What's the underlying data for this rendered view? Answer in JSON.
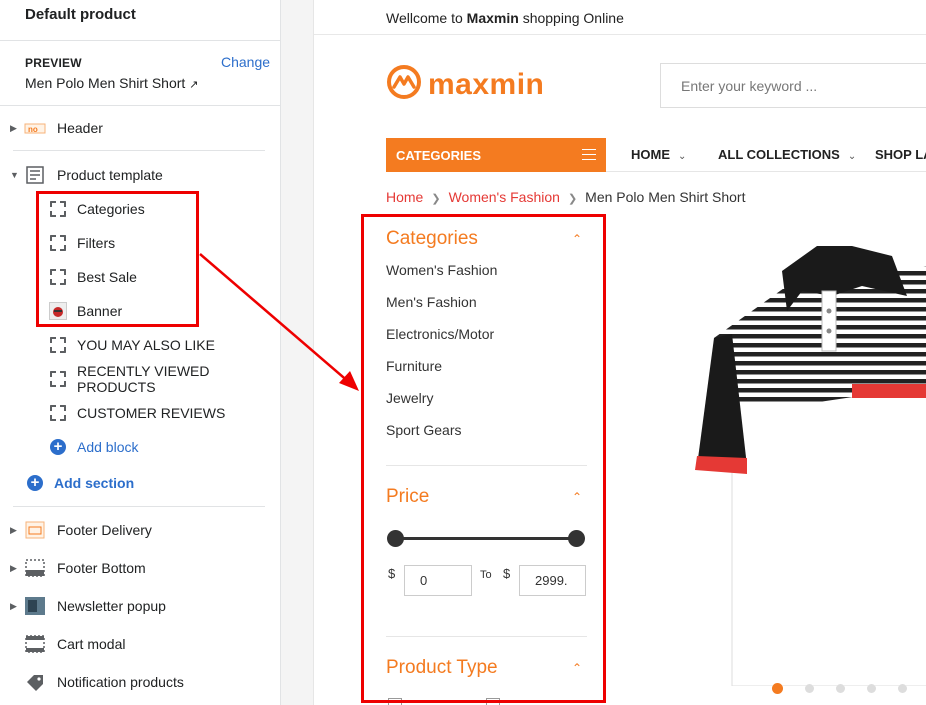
{
  "editor": {
    "title": "Default product",
    "preview_label": "PREVIEW",
    "change_label": "Change",
    "preview_product": "Men Polo Men Shirt Short",
    "sections": [
      {
        "label": "Header",
        "icon": "header-thumbnail-icon"
      },
      {
        "label": "Product template",
        "icon": "template-icon"
      },
      {
        "label": "Footer Delivery",
        "icon": "footer-delivery-thumbnail-icon"
      },
      {
        "label": "Footer Bottom",
        "icon": "footer-bottom-icon"
      },
      {
        "label": "Newsletter popup",
        "icon": "newsletter-thumbnail-icon"
      },
      {
        "label": "Cart modal",
        "icon": "cart-modal-icon"
      },
      {
        "label": "Notification products",
        "icon": "tag-icon"
      }
    ],
    "blocks": [
      {
        "label": "Categories",
        "icon": "dashed-block-icon"
      },
      {
        "label": "Filters",
        "icon": "dashed-block-icon"
      },
      {
        "label": "Best Sale",
        "icon": "dashed-block-icon"
      },
      {
        "label": "Banner",
        "icon": "banner-thumbnail-icon"
      },
      {
        "label": "YOU MAY ALSO LIKE",
        "icon": "dashed-block-icon"
      },
      {
        "label": "RECENTLY VIEWED PRODUCTS",
        "icon": "dashed-block-icon"
      },
      {
        "label": "CUSTOMER REVIEWS",
        "icon": "dashed-block-icon"
      }
    ],
    "add_block": "Add block",
    "add_section": "Add section"
  },
  "store": {
    "welcome_prefix": "Wellcome to",
    "welcome_brand": "Maxmin",
    "welcome_suffix": "shopping Online",
    "logo_text": "maxmin",
    "search_placeholder": "Enter your keyword ...",
    "categories_button": "CATEGORIES",
    "nav": [
      "HOME",
      "ALL COLLECTIONS",
      "SHOP LA"
    ],
    "breadcrumb": [
      "Home",
      "Women's Fashion",
      "Men Polo Men Shirt Short"
    ],
    "filters": {
      "categories_title": "Categories",
      "categories": [
        "Women's Fashion",
        "Men's Fashion",
        "Electronics/Motor",
        "Furniture",
        "Jewelry",
        "Sport Gears"
      ],
      "price_title": "Price",
      "currency": "$",
      "to_label": "To",
      "price_min": "0",
      "price_max": "2999.",
      "product_type_title": "Product Type"
    },
    "gallery_slide_count": 6,
    "gallery_active_slide": 1
  },
  "colors": {
    "accent": "#f47b20",
    "annotation": "#ee0000",
    "link": "#2c6ecb"
  }
}
